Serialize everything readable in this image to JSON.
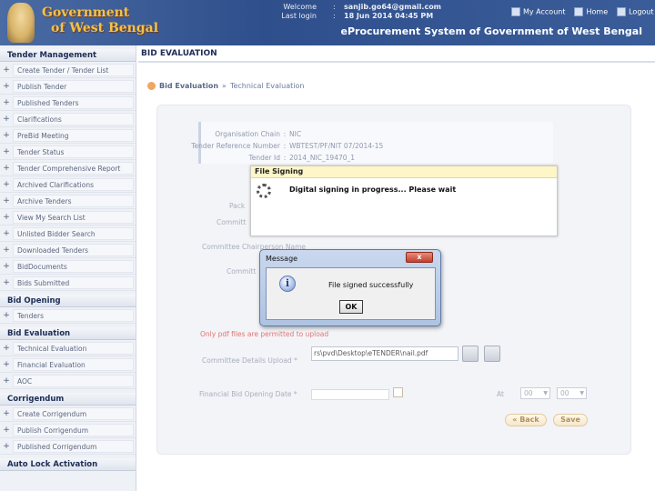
{
  "header": {
    "logo_line1": "Government",
    "logo_line2": "of West Bengal",
    "welcome_label": "Welcome",
    "welcome_value": "sanjib.go64@gmail.com",
    "lastlogin_label": "Last login",
    "lastlogin_value": "18 Jun 2014 04:45 PM",
    "colon": ":",
    "my_account": "My Account",
    "home": "Home",
    "logout": "Logout",
    "system_title": "eProcurement System of Government of West Bengal"
  },
  "sidebar": {
    "sections": [
      {
        "title": "Tender Management",
        "items": [
          "Create Tender / Tender List",
          "Publish Tender",
          "Published Tenders",
          "Clarifications",
          "PreBid Meeting",
          "Tender Status",
          "Tender Comprehensive Report",
          "Archived Clarifications",
          "Archive Tenders",
          "View My Search List",
          "Unlisted Bidder Search",
          "Downloaded Tenders",
          "BidDocuments",
          "Bids Submitted"
        ]
      },
      {
        "title": "Bid Opening",
        "items": [
          "Tenders"
        ]
      },
      {
        "title": "Bid Evaluation",
        "items": [
          "Technical Evaluation",
          "Financial Evaluation",
          "AOC"
        ]
      },
      {
        "title": "Corrigendum",
        "items": [
          "Create Corrigendum",
          "Publish Corrigendum",
          "Published Corrigendum"
        ]
      },
      {
        "title": "Auto Lock Activation",
        "items": []
      }
    ]
  },
  "main": {
    "page_heading": "BID EVALUATION",
    "crumb_root": "Bid Evaluation",
    "crumb_sep": "»",
    "crumb_current": "Technical Evaluation",
    "info": {
      "org_chain_label": "Organisation Chain",
      "org_chain_value": "NIC",
      "tender_ref_label": "Tender Reference Number",
      "tender_ref_value": "WBTEST/PF/NIT 07/2014-15",
      "tender_id_label": "Tender Id",
      "tender_id_value": "2014_NIC_19470_1"
    },
    "faded_pack": "Pack",
    "faded_committee": "Committ",
    "committee_chair_label": "Committee Chairperson Name",
    "faded_committee2": "Committ",
    "upload_note": "Only pdf files are permitted to upload",
    "committee_upload_label": "Committee Details Upload *",
    "file_path": "rs\\pvd\\Desktop\\eTENDER\\nail.pdf",
    "fin_bid_label": "Financial Bid Opening Date *",
    "at_label": "At",
    "hour_value": "00",
    "minute_value": "00",
    "back_label": "« Back",
    "save_label": "Save"
  },
  "sign_dialog": {
    "title": "File Signing",
    "message": "Digital signing in progress... Please wait"
  },
  "message_dialog": {
    "title": "Message",
    "close": "x",
    "icon": "i",
    "text": "File signed successfully",
    "ok": "OK"
  }
}
